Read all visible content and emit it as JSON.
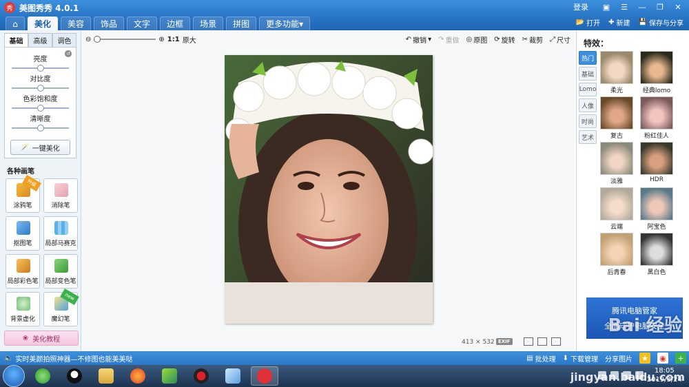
{
  "app": {
    "title": "美图秀秀 4.0.1",
    "logo_text": "秀"
  },
  "window": {
    "login": "登录"
  },
  "nav": {
    "tabs": [
      "美化",
      "美容",
      "饰品",
      "文字",
      "边框",
      "场景",
      "拼图",
      "更多功能"
    ],
    "open": "打开",
    "new": "新建",
    "save": "保存与分享"
  },
  "left_panel": {
    "subtabs": [
      "基础",
      "高级",
      "调色"
    ],
    "sliders": [
      {
        "label": "亮度",
        "value": 0.5
      },
      {
        "label": "对比度",
        "value": 0.5
      },
      {
        "label": "色彩饱和度",
        "value": 0.5
      },
      {
        "label": "清晰度",
        "value": 0.5
      }
    ],
    "one_click": "一键美化",
    "brush_title": "各种画笔",
    "brushes": [
      {
        "label": "涂鸦笔",
        "badge": "升级"
      },
      {
        "label": "消除笔",
        "badge": ""
      },
      {
        "label": "抠图笔",
        "badge": ""
      },
      {
        "label": "局部马赛克",
        "badge": ""
      },
      {
        "label": "局部彩色笔",
        "badge": ""
      },
      {
        "label": "局部变色笔",
        "badge": ""
      },
      {
        "label": "背景虚化",
        "badge": ""
      },
      {
        "label": "魔幻笔",
        "badge": "new"
      }
    ],
    "tutorial": "美化教程"
  },
  "toolbar": {
    "zoom_ratio": "1:1",
    "zoom_label": "原大",
    "undo": "撤销",
    "redo": "重做",
    "original": "原图",
    "rotate": "旋转",
    "crop": "裁剪",
    "resize": "尺寸"
  },
  "image_info": {
    "width": "413",
    "times": "×",
    "height": "532",
    "exif": "EXIF"
  },
  "right_panel": {
    "title": "特效：",
    "categories": [
      "热门",
      "基础",
      "Lomo",
      "人像",
      "时尚",
      "艺术"
    ],
    "effects": [
      "柔光",
      "经典lomo",
      "复古",
      "粉红佳人",
      "淡雅",
      "HDR",
      "云端",
      "阿宝色",
      "后青春",
      "黑白色"
    ],
    "ad_line1": "腾讯电脑管家",
    "ad_line2": "全面守护电脑安全"
  },
  "status": {
    "message": "实时美颜拍照神器—不修图也能美美哒",
    "batch": "批处理",
    "download": "下载管理",
    "share": "分享图片"
  },
  "taskbar": {
    "time": "18:05",
    "date": "2019/3/24"
  },
  "watermark": {
    "logo": "Bai 经验",
    "url": "jingyan.baidu.com"
  },
  "colors": {
    "accent": "#2b78c8",
    "nav_active": "#1d5ea8",
    "ad": "#1b56b4"
  }
}
